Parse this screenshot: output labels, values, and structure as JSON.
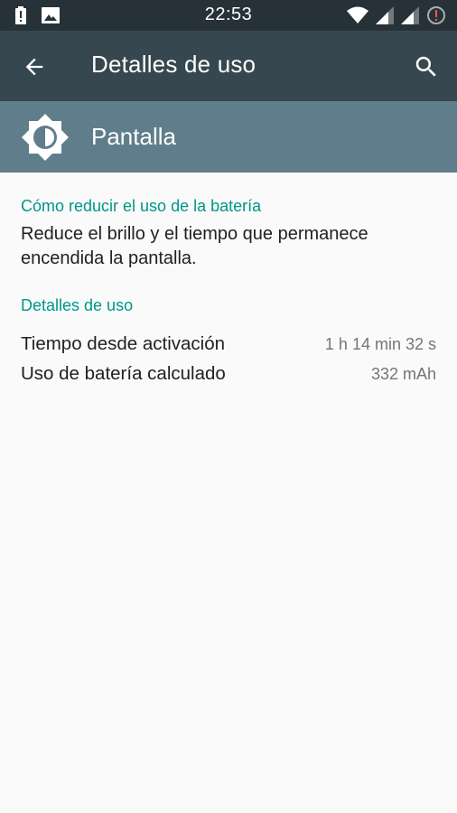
{
  "status_bar": {
    "time": "22:53",
    "icons": [
      "alert-icon",
      "image-icon",
      "wifi-icon",
      "signal-icon",
      "signal-icon",
      "battery-alert-icon"
    ]
  },
  "app_bar": {
    "title": "Detalles de uso",
    "back_icon": "arrow-back-icon",
    "search_icon": "search-icon"
  },
  "header": {
    "app_name": "Pantalla",
    "icon": "brightness-icon"
  },
  "tips": {
    "heading": "Cómo reducir el uso de la batería",
    "summary": "Reduce el brillo y el tiempo que permanece encendida la pantalla."
  },
  "usage": {
    "heading": "Detalles de uso",
    "rows": [
      {
        "label": "Tiempo desde activación",
        "value": "1 h 14 min 32 s"
      },
      {
        "label": "Uso de batería calculado",
        "value": "332 mAh"
      }
    ]
  },
  "colors": {
    "status_bar": "#263238",
    "app_bar": "#37474f",
    "header": "#607d8b",
    "accent": "#009688",
    "background": "#fafafa"
  }
}
